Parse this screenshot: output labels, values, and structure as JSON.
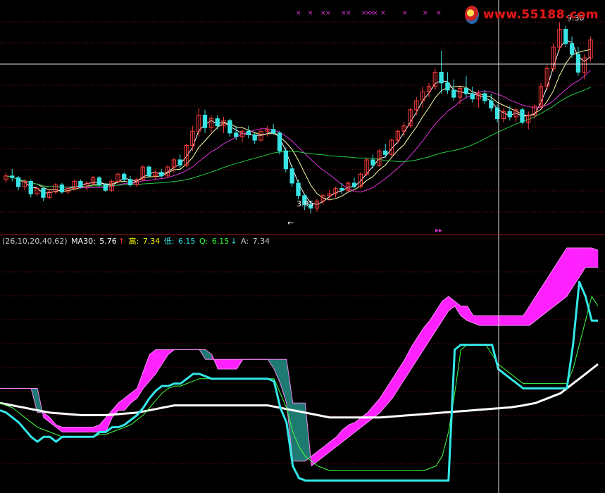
{
  "colors": {
    "background": "#000000",
    "grid": "#8a1515",
    "panel_border": "#b01818",
    "up_candle": "#ff3c3c",
    "down_candle": "#39e3e3",
    "ma_short": "#ffffff",
    "ma_mid": "#ffffaa",
    "ma_long": "#dd33dd",
    "ma_longer": "#22cc44",
    "band_magenta": "#ff22ff",
    "band_teal": "#1f7a72",
    "indicator_cyan": "#33e8e8",
    "indicator_green": "#44ff44",
    "indicator_white": "#ffffff",
    "crosshair": "#e0e0e0"
  },
  "logo": {
    "text": "www.55188.com"
  },
  "status": {
    "params": "(26,10,20,40,62)",
    "ma30_label": "MA30:",
    "ma30_value": "5.76",
    "up_arrow": "↑",
    "high_label": "高:",
    "high_value": "7.34",
    "low_label": "低:",
    "low_value": "6.15",
    "q_label": "Q:",
    "q_value": "6.15",
    "down_arrow": "↓",
    "a_label": "A:",
    "a_value": "7.34"
  },
  "chart_data": [
    {
      "type": "candlestick",
      "annotations": [
        {
          "text": "9.30",
          "at": "highest-high"
        },
        {
          "text": "3.95",
          "at": "lowest-low"
        }
      ],
      "ylim": [
        3.5,
        9.8
      ],
      "grid": true,
      "points": [
        [
          4.9,
          5.1,
          4.8,
          5.0
        ],
        [
          5.0,
          5.2,
          4.85,
          4.95
        ],
        [
          4.95,
          5.0,
          4.6,
          4.7
        ],
        [
          4.7,
          4.9,
          4.6,
          4.85
        ],
        [
          4.85,
          4.9,
          4.4,
          4.5
        ],
        [
          4.5,
          4.7,
          4.45,
          4.65
        ],
        [
          4.65,
          4.7,
          4.3,
          4.4
        ],
        [
          4.4,
          4.6,
          4.35,
          4.55
        ],
        [
          4.55,
          4.8,
          4.5,
          4.75
        ],
        [
          4.75,
          4.8,
          4.5,
          4.55
        ],
        [
          4.55,
          4.7,
          4.5,
          4.65
        ],
        [
          4.65,
          4.9,
          4.6,
          4.85
        ],
        [
          4.85,
          4.9,
          4.65,
          4.7
        ],
        [
          4.7,
          4.85,
          4.6,
          4.8
        ],
        [
          4.8,
          5.0,
          4.75,
          4.95
        ],
        [
          4.95,
          5.0,
          4.7,
          4.75
        ],
        [
          4.75,
          4.8,
          4.55,
          4.6
        ],
        [
          4.6,
          4.9,
          4.55,
          4.85
        ],
        [
          4.85,
          5.1,
          4.8,
          5.05
        ],
        [
          5.05,
          5.1,
          4.85,
          4.9
        ],
        [
          4.9,
          5.0,
          4.7,
          4.75
        ],
        [
          4.75,
          4.95,
          4.7,
          4.9
        ],
        [
          4.9,
          5.3,
          4.85,
          5.25
        ],
        [
          5.25,
          5.3,
          4.95,
          5.0
        ],
        [
          5.0,
          5.15,
          4.9,
          5.1
        ],
        [
          5.1,
          5.2,
          4.95,
          5.0
        ],
        [
          5.0,
          5.3,
          4.95,
          5.25
        ],
        [
          5.25,
          5.5,
          5.1,
          5.45
        ],
        [
          5.45,
          5.6,
          5.2,
          5.3
        ],
        [
          5.3,
          5.9,
          5.25,
          5.85
        ],
        [
          5.85,
          6.4,
          5.7,
          6.25
        ],
        [
          6.25,
          6.9,
          6.1,
          6.7
        ],
        [
          6.7,
          6.85,
          6.2,
          6.35
        ],
        [
          6.35,
          6.7,
          6.2,
          6.6
        ],
        [
          6.6,
          6.7,
          6.3,
          6.4
        ],
        [
          6.4,
          6.65,
          6.2,
          6.55
        ],
        [
          6.55,
          6.6,
          6.1,
          6.2
        ],
        [
          6.2,
          6.4,
          6.0,
          6.1
        ],
        [
          6.1,
          6.3,
          5.95,
          6.25
        ],
        [
          6.25,
          6.4,
          6.05,
          6.15
        ],
        [
          6.15,
          6.2,
          5.9,
          6.0
        ],
        [
          6.0,
          6.3,
          5.95,
          6.25
        ],
        [
          6.25,
          6.4,
          6.1,
          6.3
        ],
        [
          6.3,
          6.45,
          6.15,
          6.2
        ],
        [
          6.2,
          6.25,
          5.6,
          5.7
        ],
        [
          5.7,
          5.8,
          5.1,
          5.2
        ],
        [
          5.2,
          5.3,
          4.7,
          4.8
        ],
        [
          4.8,
          4.9,
          4.35,
          4.45
        ],
        [
          4.45,
          4.5,
          4.05,
          4.2
        ],
        [
          4.2,
          4.3,
          3.95,
          4.1
        ],
        [
          4.1,
          4.35,
          4.0,
          4.3
        ],
        [
          4.3,
          4.5,
          4.2,
          4.45
        ],
        [
          4.45,
          4.6,
          4.3,
          4.5
        ],
        [
          4.5,
          4.7,
          4.4,
          4.65
        ],
        [
          4.65,
          4.8,
          4.5,
          4.6
        ],
        [
          4.6,
          4.85,
          4.55,
          4.8
        ],
        [
          4.8,
          4.95,
          4.65,
          4.7
        ],
        [
          4.7,
          5.1,
          4.65,
          5.05
        ],
        [
          5.05,
          5.5,
          5.0,
          5.45
        ],
        [
          5.45,
          5.6,
          5.2,
          5.3
        ],
        [
          5.3,
          5.75,
          5.25,
          5.7
        ],
        [
          5.7,
          5.9,
          5.5,
          5.6
        ],
        [
          5.6,
          6.05,
          5.55,
          6.0
        ],
        [
          6.0,
          6.3,
          5.9,
          6.25
        ],
        [
          6.25,
          6.5,
          6.1,
          6.4
        ],
        [
          6.4,
          6.9,
          6.35,
          6.85
        ],
        [
          6.85,
          7.2,
          6.7,
          7.1
        ],
        [
          7.1,
          7.5,
          6.9,
          7.35
        ],
        [
          7.35,
          7.6,
          7.2,
          7.5
        ],
        [
          7.5,
          8.0,
          7.4,
          7.9
        ],
        [
          7.9,
          8.5,
          7.3,
          7.6
        ],
        [
          7.6,
          7.9,
          7.3,
          7.4
        ],
        [
          7.4,
          7.7,
          7.1,
          7.2
        ],
        [
          7.2,
          7.5,
          7.0,
          7.45
        ],
        [
          7.45,
          7.8,
          7.2,
          7.3
        ],
        [
          7.3,
          7.5,
          7.05,
          7.15
        ],
        [
          7.15,
          7.4,
          6.9,
          7.3
        ],
        [
          7.3,
          7.4,
          7.0,
          7.1
        ],
        [
          7.1,
          7.3,
          6.8,
          6.9
        ],
        [
          6.9,
          7.0,
          6.5,
          6.6
        ],
        [
          6.6,
          6.9,
          6.5,
          6.8
        ],
        [
          6.8,
          6.95,
          6.55,
          6.65
        ],
        [
          6.65,
          6.9,
          6.5,
          6.85
        ],
        [
          6.85,
          6.9,
          6.45,
          6.5
        ],
        [
          6.5,
          6.8,
          6.3,
          6.7
        ],
        [
          6.7,
          7.0,
          6.6,
          6.95
        ],
        [
          6.95,
          7.6,
          6.9,
          7.5
        ],
        [
          7.5,
          8.1,
          7.4,
          8.0
        ],
        [
          8.0,
          8.7,
          7.9,
          8.6
        ],
        [
          8.6,
          9.3,
          8.5,
          9.1
        ],
        [
          9.1,
          9.2,
          8.6,
          8.7
        ],
        [
          8.7,
          8.9,
          8.3,
          8.4
        ],
        [
          8.4,
          8.6,
          7.8,
          7.9
        ],
        [
          7.9,
          8.4,
          7.7,
          8.3
        ],
        [
          8.3,
          8.9,
          8.2,
          8.8
        ]
      ]
    },
    {
      "type": "line",
      "ylim": [
        0,
        1
      ],
      "series": [
        {
          "name": "upper",
          "values": [
            0.42,
            0.42,
            0.42,
            0.42,
            0.42,
            0.42,
            0.32,
            0.32,
            0.3,
            0.27,
            0.26,
            0.26,
            0.26,
            0.26,
            0.26,
            0.26,
            0.27,
            0.3,
            0.33,
            0.36,
            0.38,
            0.4,
            0.42,
            0.49,
            0.56,
            0.58,
            0.58,
            0.58,
            0.58,
            0.58,
            0.58,
            0.58,
            0.58,
            0.54,
            0.54,
            0.54,
            0.54,
            0.54,
            0.54,
            0.54,
            0.54,
            0.54,
            0.54,
            0.54,
            0.5,
            0.44,
            0.36,
            0.12,
            0.12,
            0.12,
            0.14,
            0.16,
            0.18,
            0.2,
            0.22,
            0.25,
            0.27,
            0.28,
            0.3,
            0.32,
            0.35,
            0.38,
            0.42,
            0.46,
            0.5,
            0.54,
            0.59,
            0.63,
            0.67,
            0.7,
            0.74,
            0.78,
            0.8,
            0.78,
            0.76,
            0.76,
            0.72,
            0.72,
            0.72,
            0.72,
            0.72,
            0.72,
            0.72,
            0.72,
            0.72,
            0.76,
            0.8,
            0.84,
            0.88,
            0.92,
            0.96,
            1.0,
            1.0,
            1.0,
            1.0,
            1.0,
            0.99
          ]
        },
        {
          "name": "lower",
          "values": [
            0.42,
            0.42,
            0.42,
            0.42,
            0.42,
            0.42,
            0.42,
            0.3,
            0.28,
            0.26,
            0.24,
            0.24,
            0.24,
            0.24,
            0.24,
            0.24,
            0.24,
            0.24,
            0.3,
            0.33,
            0.33,
            0.36,
            0.38,
            0.42,
            0.45,
            0.48,
            0.52,
            0.56,
            0.58,
            0.58,
            0.58,
            0.58,
            0.58,
            0.58,
            0.56,
            0.5,
            0.5,
            0.5,
            0.5,
            0.54,
            0.54,
            0.54,
            0.54,
            0.54,
            0.54,
            0.54,
            0.54,
            0.36,
            0.36,
            0.36,
            0.1,
            0.12,
            0.14,
            0.16,
            0.18,
            0.2,
            0.22,
            0.24,
            0.26,
            0.28,
            0.3,
            0.32,
            0.35,
            0.38,
            0.42,
            0.46,
            0.5,
            0.54,
            0.58,
            0.62,
            0.66,
            0.7,
            0.74,
            0.76,
            0.72,
            0.7,
            0.69,
            0.68,
            0.68,
            0.68,
            0.68,
            0.68,
            0.68,
            0.68,
            0.68,
            0.68,
            0.7,
            0.72,
            0.74,
            0.76,
            0.78,
            0.8,
            0.84,
            0.88,
            0.92,
            0.92,
            0.92
          ]
        },
        {
          "name": "cyan",
          "values": [
            0.33,
            0.32,
            0.3,
            0.28,
            0.25,
            0.22,
            0.2,
            0.22,
            0.22,
            0.2,
            0.22,
            0.22,
            0.22,
            0.22,
            0.22,
            0.22,
            0.24,
            0.24,
            0.26,
            0.26,
            0.27,
            0.29,
            0.31,
            0.34,
            0.38,
            0.41,
            0.43,
            0.43,
            0.44,
            0.44,
            0.46,
            0.48,
            0.48,
            0.47,
            0.46,
            0.46,
            0.46,
            0.46,
            0.46,
            0.46,
            0.46,
            0.46,
            0.46,
            0.46,
            0.45,
            0.34,
            0.28,
            0.1,
            0.05,
            0.04,
            0.04,
            0.04,
            0.04,
            0.04,
            0.04,
            0.04,
            0.04,
            0.04,
            0.04,
            0.04,
            0.04,
            0.04,
            0.04,
            0.04,
            0.04,
            0.04,
            0.04,
            0.04,
            0.04,
            0.04,
            0.04,
            0.04,
            0.04,
            0.58,
            0.6,
            0.6,
            0.6,
            0.6,
            0.6,
            0.6,
            0.5,
            0.48,
            0.46,
            0.44,
            0.42,
            0.42,
            0.42,
            0.42,
            0.42,
            0.42,
            0.42,
            0.42,
            0.6,
            0.86,
            0.8,
            0.7,
            0.7
          ]
        },
        {
          "name": "green",
          "values": [
            0.36,
            0.35,
            0.34,
            0.32,
            0.3,
            0.28,
            0.26,
            0.25,
            0.24,
            0.23,
            0.22,
            0.22,
            0.22,
            0.22,
            0.22,
            0.22,
            0.23,
            0.23,
            0.24,
            0.25,
            0.26,
            0.27,
            0.29,
            0.31,
            0.34,
            0.37,
            0.4,
            0.42,
            0.43,
            0.43,
            0.44,
            0.45,
            0.46,
            0.46,
            0.46,
            0.46,
            0.46,
            0.46,
            0.46,
            0.46,
            0.46,
            0.46,
            0.46,
            0.46,
            0.46,
            0.4,
            0.34,
            0.24,
            0.18,
            0.14,
            0.12,
            0.1,
            0.09,
            0.08,
            0.08,
            0.08,
            0.08,
            0.08,
            0.08,
            0.08,
            0.08,
            0.08,
            0.08,
            0.08,
            0.08,
            0.08,
            0.08,
            0.08,
            0.08,
            0.09,
            0.1,
            0.14,
            0.24,
            0.4,
            0.58,
            0.6,
            0.6,
            0.6,
            0.6,
            0.56,
            0.52,
            0.5,
            0.48,
            0.46,
            0.44,
            0.44,
            0.44,
            0.44,
            0.44,
            0.44,
            0.44,
            0.44,
            0.5,
            0.6,
            0.7,
            0.8,
            0.76
          ]
        },
        {
          "name": "white",
          "values": [
            0.36,
            0.355,
            0.35,
            0.345,
            0.34,
            0.335,
            0.33,
            0.325,
            0.32,
            0.318,
            0.316,
            0.314,
            0.312,
            0.31,
            0.31,
            0.31,
            0.31,
            0.31,
            0.312,
            0.314,
            0.316,
            0.318,
            0.32,
            0.325,
            0.33,
            0.335,
            0.34,
            0.345,
            0.35,
            0.35,
            0.35,
            0.35,
            0.35,
            0.35,
            0.35,
            0.35,
            0.35,
            0.35,
            0.35,
            0.35,
            0.35,
            0.35,
            0.35,
            0.35,
            0.345,
            0.34,
            0.335,
            0.33,
            0.325,
            0.32,
            0.315,
            0.31,
            0.305,
            0.3,
            0.3,
            0.3,
            0.3,
            0.3,
            0.3,
            0.3,
            0.3,
            0.3,
            0.302,
            0.304,
            0.306,
            0.308,
            0.31,
            0.312,
            0.314,
            0.316,
            0.318,
            0.32,
            0.322,
            0.324,
            0.326,
            0.328,
            0.33,
            0.332,
            0.334,
            0.336,
            0.338,
            0.34,
            0.342,
            0.346,
            0.35,
            0.355,
            0.36,
            0.37,
            0.38,
            0.39,
            0.4,
            0.42,
            0.44,
            0.46,
            0.48,
            0.5,
            0.52
          ]
        }
      ]
    }
  ]
}
